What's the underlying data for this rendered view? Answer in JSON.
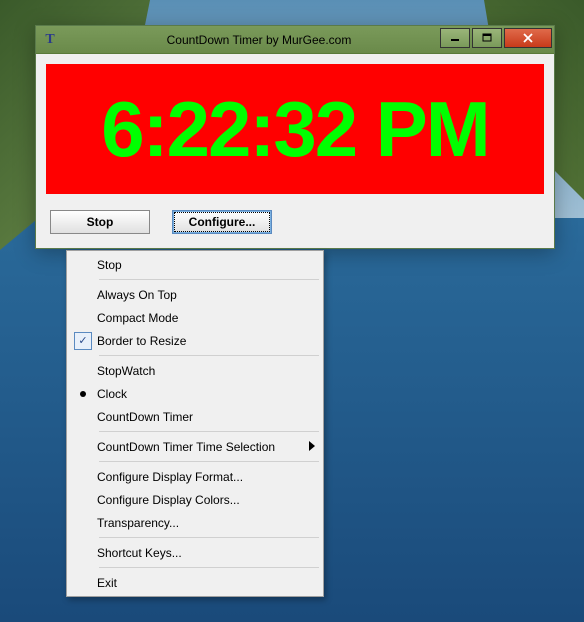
{
  "window": {
    "title": "CountDown Timer by MurGee.com",
    "icon_letter": "T"
  },
  "display": {
    "time_text": "6:22:32 PM"
  },
  "buttons": {
    "stop": "Stop",
    "configure": "Configure..."
  },
  "menu": {
    "stop": "Stop",
    "always_on_top": "Always On Top",
    "compact_mode": "Compact Mode",
    "border_to_resize": "Border to Resize",
    "stopwatch": "StopWatch",
    "clock": "Clock",
    "countdown_timer": "CountDown Timer",
    "time_selection": "CountDown Timer Time Selection",
    "display_format": "Configure Display Format...",
    "display_colors": "Configure Display Colors...",
    "transparency": "Transparency...",
    "shortcut_keys": "Shortcut Keys...",
    "exit": "Exit"
  }
}
